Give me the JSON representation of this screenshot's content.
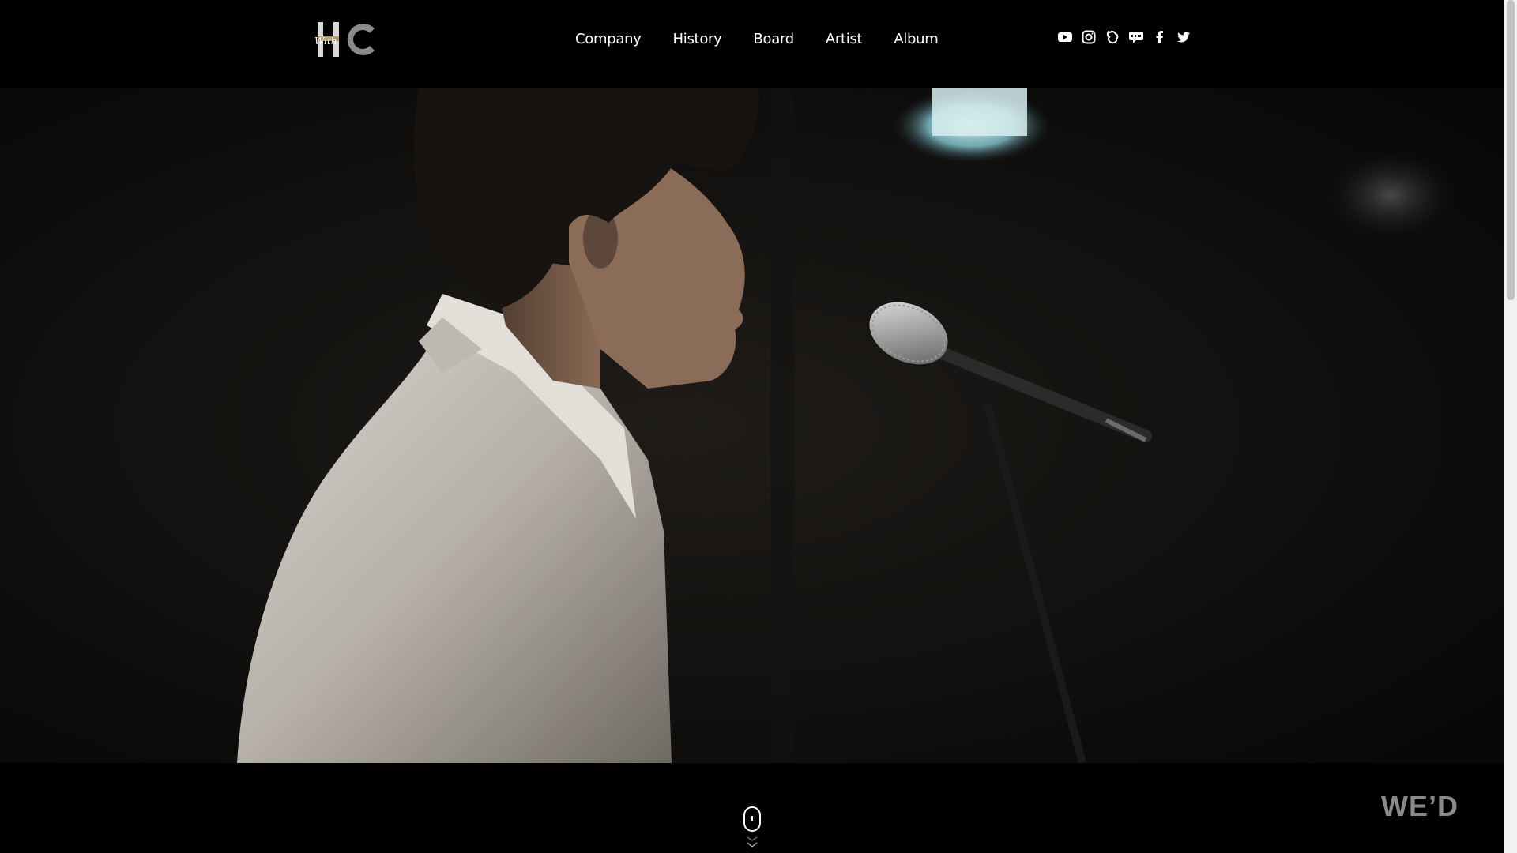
{
  "header": {
    "logo": {
      "alt": "with HC",
      "script_text": "With",
      "letters": "HC"
    },
    "nav": [
      {
        "label": "Company"
      },
      {
        "label": "History"
      },
      {
        "label": "Board"
      },
      {
        "label": "Artist"
      },
      {
        "label": "Album"
      }
    ],
    "social": [
      "youtube-icon",
      "instagram-icon",
      "fan-cafe-icon",
      "talk-icon",
      "facebook-icon",
      "twitter-icon"
    ]
  },
  "hero": {
    "scene": "singer-with-microphone-video"
  },
  "footer": {
    "brand_mark": "WE’D",
    "scroll_hint": "mouse-scroll-icon"
  },
  "colors": {
    "background": "#000000",
    "nav_text": "#ffffff",
    "logo_gold": "#b89a6a",
    "logo_gray": "#8b8b8b",
    "brand_mark": "#8a8a8a"
  }
}
